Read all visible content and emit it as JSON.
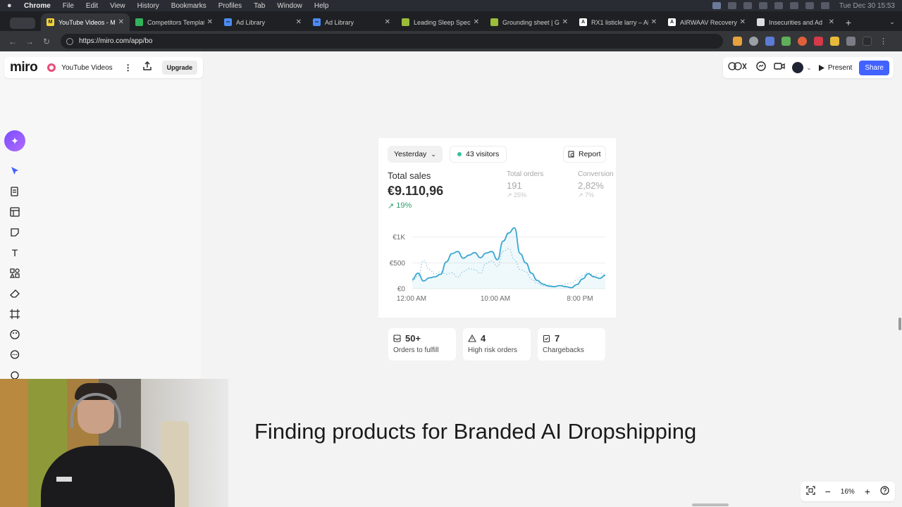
{
  "menubar": {
    "app": "Chrome",
    "items": [
      "File",
      "Edit",
      "View",
      "History",
      "Bookmarks",
      "Profiles",
      "Tab",
      "Window",
      "Help"
    ],
    "clock": "Tue Dec 30  15:53"
  },
  "tabs": [
    {
      "label": "YouTube Videos - Mi",
      "favicon_color": "#f2d23c",
      "favicon_glyph": "M",
      "active": true
    },
    {
      "label": "Competitors Templat",
      "favicon_color": "#2fb45a",
      "favicon_glyph": "",
      "active": false
    },
    {
      "label": "Ad Library",
      "favicon_color": "#4c8bf5",
      "favicon_glyph": "∞",
      "active": false
    },
    {
      "label": "Ad Library",
      "favicon_color": "#4c8bf5",
      "favicon_glyph": "∞",
      "active": false
    },
    {
      "label": "Leading Sleep Speci",
      "favicon_color": "#9bbd3a",
      "favicon_glyph": "",
      "active": false
    },
    {
      "label": "Grounding sheet | Gr",
      "favicon_color": "#9bbd3a",
      "favicon_glyph": "",
      "active": false
    },
    {
      "label": "RX1 listicle larry – All",
      "favicon_color": "#ffffff",
      "favicon_glyph": "A",
      "active": false
    },
    {
      "label": "AIRWAAV Recovery",
      "favicon_color": "#ffffff",
      "favicon_glyph": "A",
      "active": false
    },
    {
      "label": "Insecurities and Ad",
      "favicon_color": "#dddddd",
      "favicon_glyph": "",
      "active": false
    }
  ],
  "address": {
    "url": "https://miro.com/app/bo"
  },
  "miro": {
    "logo": "miro",
    "board_name": "YouTube Videos",
    "upgrade_label": "Upgrade",
    "present_label": "Present",
    "share_label": "Share",
    "zoom_level": "16%"
  },
  "dashboard": {
    "period_label": "Yesterday",
    "visitors_label": "43 visitors",
    "report_label": "Report",
    "total_sales_label": "Total sales",
    "total_sales_value": "€9.110,96",
    "total_sales_change": "19%",
    "total_orders_label": "Total orders",
    "total_orders_value": "191",
    "total_orders_change": "25%",
    "conversion_label": "Conversion",
    "conversion_value": "2,82%",
    "conversion_change": "7%",
    "cards": [
      {
        "value": "50+",
        "label": "Orders to fulfill"
      },
      {
        "value": "4",
        "label": "High risk orders"
      },
      {
        "value": "7",
        "label": "Chargebacks"
      }
    ]
  },
  "chart_data": {
    "type": "line",
    "y_tick_labels": [
      "€0",
      "€500",
      "€1K"
    ],
    "x_tick_labels": [
      "12:00 AM",
      "10:00 AM",
      "8:00 PM"
    ],
    "ylim": [
      0,
      1200
    ],
    "x": [
      0,
      1,
      2,
      3,
      4,
      5,
      6,
      7,
      8,
      9,
      10,
      11,
      12,
      13,
      14,
      15,
      16,
      17,
      18,
      19,
      20,
      21,
      22,
      23,
      24,
      25,
      26,
      27,
      28,
      29,
      30,
      31,
      32,
      33,
      34,
      35,
      36,
      37,
      38,
      39,
      40,
      41,
      42,
      43,
      44,
      45,
      46,
      47
    ],
    "series": [
      {
        "values": [
          180,
          300,
          150,
          210,
          230,
          280,
          520,
          680,
          720,
          590,
          650,
          700,
          600,
          690,
          720,
          560,
          920,
          1080,
          1180,
          680,
          500,
          300,
          160,
          90,
          50,
          40,
          60,
          40,
          20,
          80,
          190,
          290,
          230,
          200,
          260
        ]
      },
      {
        "values": [
          150,
          240,
          550,
          370,
          290,
          330,
          280,
          310,
          220,
          330,
          390,
          370,
          300,
          490,
          540,
          430,
          720,
          780,
          560,
          370,
          330,
          180,
          110,
          60,
          80,
          40,
          60,
          90,
          110,
          170,
          250,
          320,
          250,
          300,
          280
        ]
      }
    ],
    "grid": true
  },
  "headline": "Finding products for Branded AI Dropshipping"
}
